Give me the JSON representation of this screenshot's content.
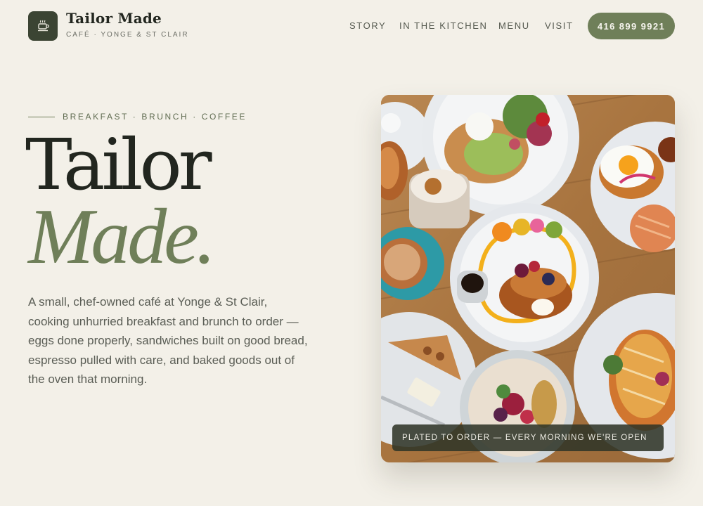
{
  "brand": {
    "name": "Tailor Made",
    "subtitle": "CAFÉ · YONGE & ST CLAIR"
  },
  "nav": {
    "items": [
      "STORY",
      "IN THE KITCHEN",
      "MENU",
      "VISIT"
    ],
    "phone": "416 899 9921"
  },
  "hero": {
    "eyebrow": "BREAKFAST · BRUNCH · COFFEE",
    "title_line1": "Tailor",
    "title_line2": "Made.",
    "intro": "A small, chef-owned café at Yonge & St Clair, cooking unhurried breakfast and brunch to order — eggs done properly, sandwiches built on good bread, espresso pulled with care, and baked goods out of the oven that morning.",
    "image_caption": "PLATED TO ORDER — EVERY MORNING WE'RE OPEN"
  },
  "colors": {
    "background": "#f3f0e8",
    "accent_green": "#6f7f59",
    "dark_green": "#3b4433",
    "ink": "#22261f"
  },
  "icons": {
    "logo": "coffee-cup-icon"
  }
}
